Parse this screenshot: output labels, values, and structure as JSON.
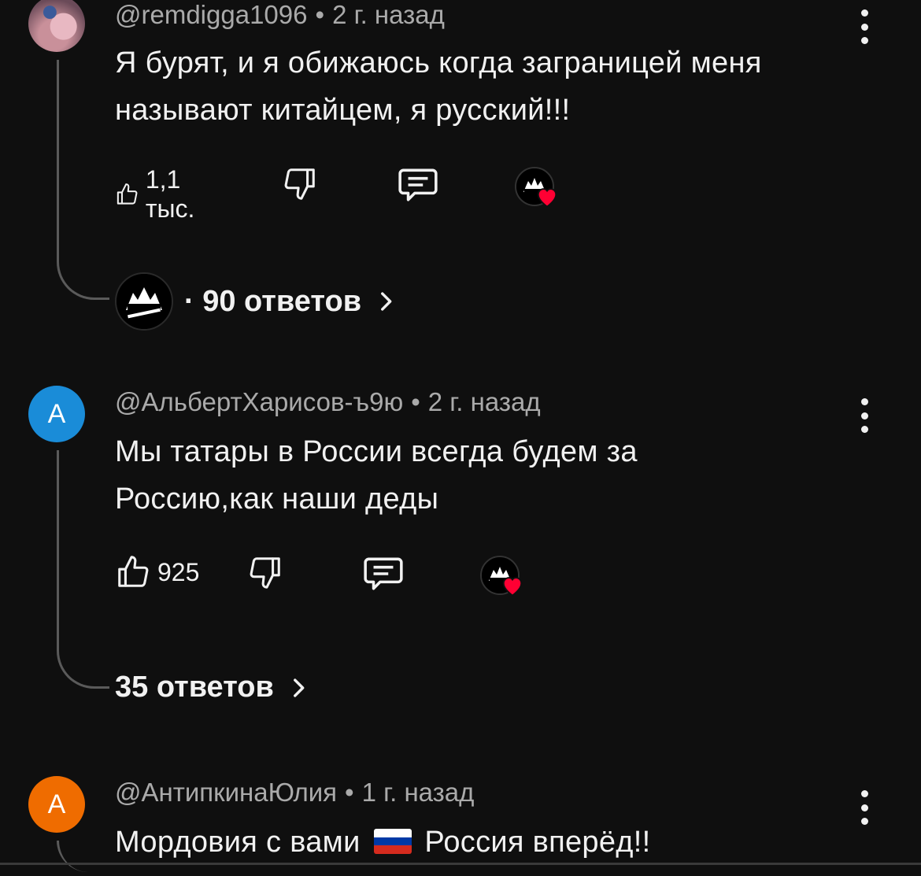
{
  "comments": [
    {
      "author": "@remdigga1096",
      "time": "2 г. назад",
      "text": "Я бурят, и я обижаюсь когда заграницей меня называют китайцем, я русский!!!",
      "likes": "1,1 тыс.",
      "replies": "· 90 ответов"
    },
    {
      "avatar_letter": "А",
      "avatar_color": "#1a8cd8",
      "author": "@АльбертХарисов-ъ9ю",
      "time": "2 г. назад",
      "text": "Мы татары в России всегда будем за Россию,как наши деды",
      "likes": "925",
      "replies": "35 ответов"
    },
    {
      "avatar_letter": "А",
      "avatar_color": "#ef6c00",
      "author": "@АнтипкинаЮлия",
      "time": "1 г. назад",
      "text_before_flag": "Мордовия с вами",
      "text_after_flag": "Россия вперёд!!"
    }
  ],
  "meta_separator": "•",
  "icons": {
    "like": "thumb-up-icon",
    "dislike": "thumb-down-icon",
    "reply": "comment-icon",
    "heart": "heart-icon",
    "more": "more-vertical-icon",
    "chevron": "chevron-right-icon"
  },
  "colors": {
    "background": "#0f0f0f",
    "heart": "#ff0033"
  }
}
